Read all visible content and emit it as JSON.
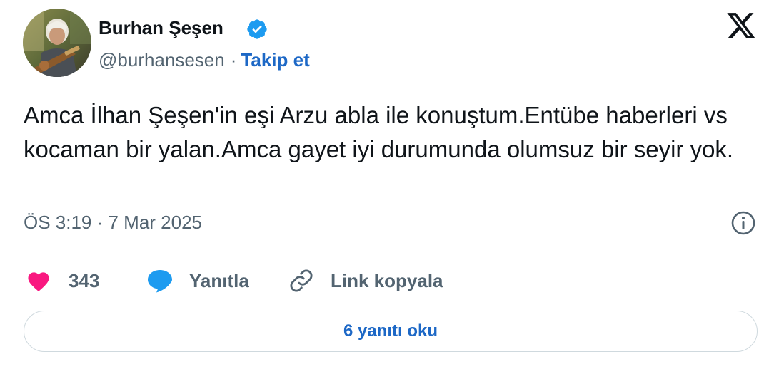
{
  "author": {
    "name": "Burhan Şeşen",
    "handle": "@burhansesen",
    "separator": "·",
    "follow_label": "Takip et"
  },
  "tweet": {
    "text": "Amca İlhan Şeşen'in eşi Arzu abla ile konuştum.Entübe haberleri vs kocaman bir yalan.Amca gayet iyi durumunda olumsuz bir seyir yok.",
    "timestamp": "ÖS 3:19 · 7 Mar 2025"
  },
  "actions": {
    "likes_count": "343",
    "reply_label": "Yanıtla",
    "copy_link_label": "Link kopyala"
  },
  "replies": {
    "read_label": "6 yanıtı oku"
  },
  "icons": {
    "verified": "verified-badge-icon",
    "platform": "x-logo-icon",
    "info": "info-icon",
    "like": "heart-icon",
    "reply": "speech-bubble-icon",
    "copy_link": "link-icon"
  },
  "colors": {
    "accent": "#1d68c6",
    "verified": "#1d9bf0",
    "like": "#f91880",
    "muted_text": "#536471",
    "primary_text": "#0f1419",
    "border": "#cfd9de"
  }
}
